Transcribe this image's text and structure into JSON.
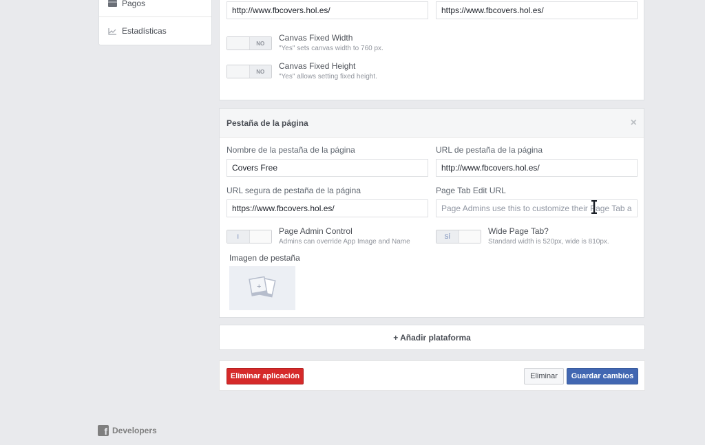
{
  "sidebar": {
    "items": [
      {
        "label": "Pagos",
        "icon": "card-icon"
      },
      {
        "label": "Estadísticas",
        "icon": "chart-icon"
      }
    ]
  },
  "canvas_section": {
    "secure_url_left": "http://www.fbcovers.hol.es/",
    "secure_url_right": "https://www.fbcovers.hol.es/",
    "toggles": [
      {
        "title": "Canvas Fixed Width",
        "desc": "\"Yes\" sets canvas width to 760 px.",
        "state_label": "NO",
        "on": false
      },
      {
        "title": "Canvas Fixed Height",
        "desc": "\"Yes\" allows setting fixed height.",
        "state_label": "NO",
        "on": false
      }
    ]
  },
  "page_tab_section": {
    "title": "Pestaña de la página",
    "close_label": "×",
    "fields": {
      "tab_name": {
        "label": "Nombre de la pestaña de la página",
        "value": "Covers Free"
      },
      "tab_url": {
        "label": "URL de pestaña de la página",
        "value": "http://www.fbcovers.hol.es/"
      },
      "secure_tab_url": {
        "label": "URL segura de pestaña de la página",
        "value": "https://www.fbcovers.hol.es/"
      },
      "edit_url": {
        "label": "Page Tab Edit URL",
        "value": "",
        "placeholder": "Page Admins use this to customize their Page Tab app"
      }
    },
    "toggles": [
      {
        "title": "Page Admin Control",
        "desc": "Admins can override App Image and Name",
        "state_label": "I",
        "on": true
      },
      {
        "title": "Wide Page Tab?",
        "desc": "Standard width is 520px, wide is 810px.",
        "state_label": "SÍ",
        "on": true
      }
    ],
    "image_label": "Imagen de pestaña"
  },
  "add_platform": {
    "label": "+ Añadir plataforma"
  },
  "actions": {
    "delete_app": "Eliminar aplicación",
    "delete": "Eliminar",
    "save": "Guardar cambios"
  },
  "footer": {
    "logo_letter": "f",
    "label": "Developers"
  },
  "colors": {
    "primary": "#4267b2",
    "danger": "#d52a2a",
    "background": "#e9eaed"
  }
}
